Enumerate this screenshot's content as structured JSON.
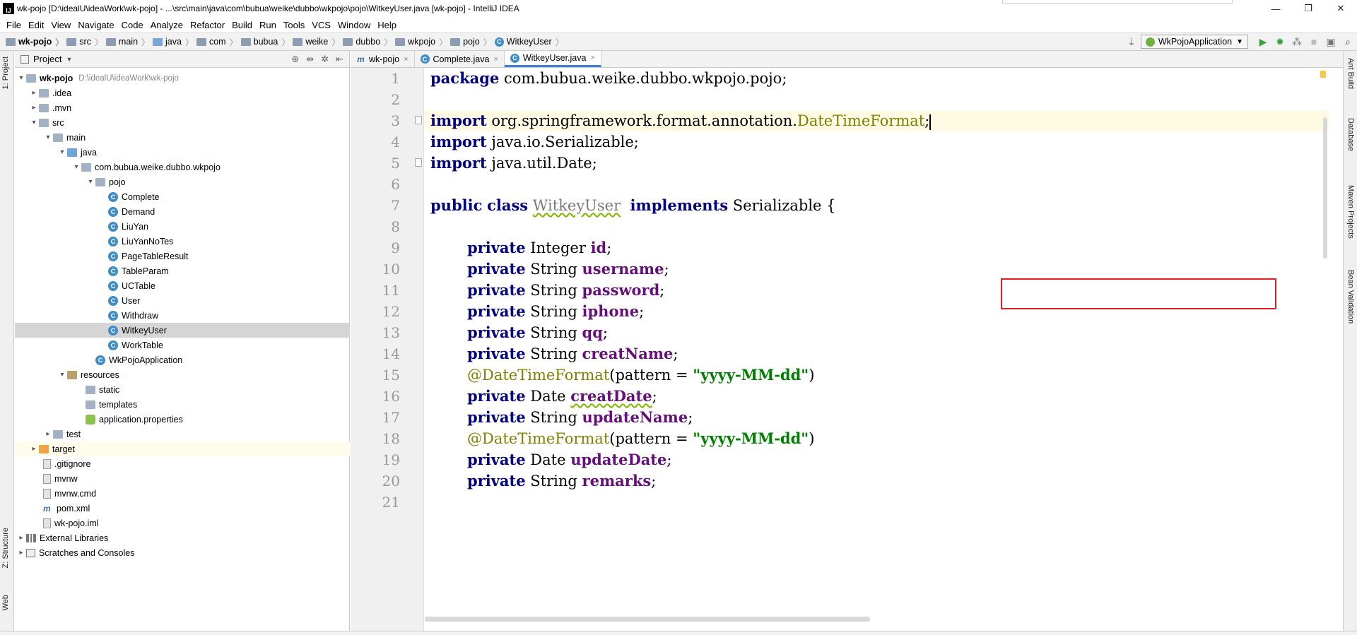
{
  "window": {
    "title": "wk-pojo [D:\\idealU\\ideaWork\\wk-pojo] - ...\\src\\main\\java\\com\\bubua\\weike\\dubbo\\wkpojo\\pojo\\WitkeyUser.java [wk-pojo] - IntelliJ IDEA",
    "app_icon": "IJ",
    "controls": {
      "minimize": "—",
      "restore": "❐",
      "close": "✕"
    }
  },
  "menu": [
    "File",
    "Edit",
    "View",
    "Navigate",
    "Code",
    "Analyze",
    "Refactor",
    "Build",
    "Run",
    "Tools",
    "VCS",
    "Window",
    "Help"
  ],
  "breadcrumb": [
    "wk-pojo",
    "src",
    "main",
    "java",
    "com",
    "bubua",
    "weike",
    "dubbo",
    "wkpojo",
    "pojo",
    "WitkeyUser"
  ],
  "run_config": "WkPojoApplication",
  "left_tabs": {
    "project": "1: Project",
    "structure": "Z: Structure",
    "web": "Web"
  },
  "right_tabs": {
    "ant": "Ant Build",
    "database": "Database",
    "maven": "Maven Projects",
    "bean": "Bean Validation"
  },
  "project_panel": {
    "title": "Project",
    "root": "wk-pojo",
    "root_path": "D:\\idealU\\ideaWork\\wk-pojo",
    "items": [
      ".idea",
      ".mvn",
      "src",
      "main",
      "java",
      "com.bubua.weike.dubbo.wkpojo",
      "pojo",
      "Complete",
      "Demand",
      "LiuYan",
      "LiuYanNoTes",
      "PageTableResult",
      "TableParam",
      "UCTable",
      "User",
      "Withdraw",
      "WitkeyUser",
      "WorkTable",
      "WkPojoApplication",
      "resources",
      "static",
      "templates",
      "application.properties",
      "test",
      "target",
      ".gitignore",
      "mvnw",
      "mvnw.cmd",
      "pom.xml",
      "wk-pojo.iml",
      "External Libraries",
      "Scratches and Consoles"
    ]
  },
  "tabs": [
    "wk-pojo",
    "Complete.java",
    "WitkeyUser.java"
  ],
  "code": {
    "line_numbers": [
      "1",
      "2",
      "3",
      "4",
      "5",
      "6",
      "7",
      "8",
      "9",
      "10",
      "11",
      "12",
      "13",
      "14",
      "15",
      "16",
      "17",
      "18",
      "19",
      "20",
      "21"
    ],
    "package_kw": "package",
    "package_name": " com.bubua.weike.dubbo.wkpojo.pojo;",
    "import_kw": "import",
    "import1_pkg": " org.springframework.format.annotation.",
    "import1_cls": "DateTimeFormat",
    "import2": " java.io.Serializable;",
    "import3": " java.util.Date;",
    "public_kw": "public",
    "class_kw": "class",
    "class_name": "WitkeyUser",
    "implements_kw": "implements",
    "iface": " Serializable {",
    "private_kw": "private",
    "types": {
      "integer": " Integer ",
      "string": " String ",
      "date": " Date "
    },
    "fields": [
      "id",
      "username",
      "password",
      "iphone",
      "qq",
      "creatName",
      "creatDate",
      "updateName",
      "updateDate",
      "remarks"
    ],
    "annotation": "@DateTimeFormat",
    "ann_open": "(pattern = ",
    "ann_str": "\"yyyy-MM-dd\"",
    "ann_close": ")",
    "semicolon": ";"
  }
}
